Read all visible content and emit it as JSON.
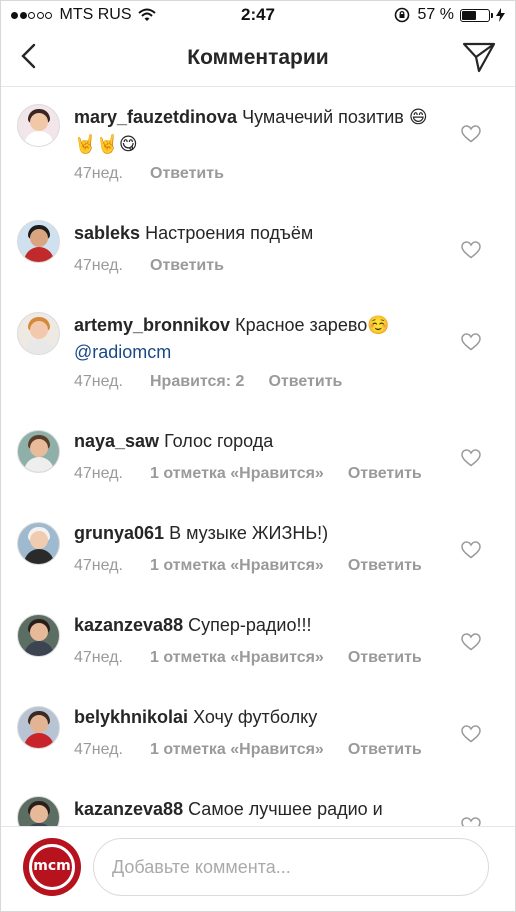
{
  "status_bar": {
    "carrier": "MTS RUS",
    "time": "2:47",
    "battery": "57 %",
    "battery_level": 0.57
  },
  "header": {
    "title": "Комментарии"
  },
  "comments": [
    {
      "username": "mary_fauzetdinova",
      "text": "Чумачечий позитив 😄🤘🤘😋",
      "mention": "",
      "age": "47нед.",
      "likes": "",
      "reply": "Ответить"
    },
    {
      "username": "sableks",
      "text": "Настроения подъём",
      "mention": "",
      "age": "47нед.",
      "likes": "",
      "reply": "Ответить"
    },
    {
      "username": "artemy_bronnikov",
      "text": "Красное зарево☺️",
      "mention": "@radiomcm",
      "age": "47нед.",
      "likes": "Нравится: 2",
      "reply": "Ответить"
    },
    {
      "username": "naya_saw",
      "text": "Голос города",
      "mention": "",
      "age": "47нед.",
      "likes": "1 отметка «Нравится»",
      "reply": "Ответить"
    },
    {
      "username": "grunya061",
      "text": "В музыке ЖИЗНЬ!)",
      "mention": "",
      "age": "47нед.",
      "likes": "1 отметка «Нравится»",
      "reply": "Ответить"
    },
    {
      "username": "kazanzeva88",
      "text": "Супер-радио!!!",
      "mention": "",
      "age": "47нед.",
      "likes": "1 отметка «Нравится»",
      "reply": "Ответить"
    },
    {
      "username": "belykhnikolai",
      "text": "Хочу футболку",
      "mention": "",
      "age": "47нед.",
      "likes": "1 отметка «Нравится»",
      "reply": "Ответить"
    },
    {
      "username": "kazanzeva88",
      "text": "Самое лучшее радио и",
      "mention": "",
      "age": "",
      "likes": "",
      "reply": ""
    }
  ],
  "composer": {
    "avatar_mark": "mcm",
    "placeholder": "Добавьте коммента..."
  },
  "icons": {
    "back": "chevron-left-icon",
    "send": "paper-plane-icon",
    "like": "heart-outline-icon",
    "wifi": "wifi-icon",
    "orientation_lock": "orientation-lock-icon",
    "battery": "battery-icon",
    "charging": "charging-bolt-icon"
  },
  "colors": {
    "text": "#262626",
    "meta": "#9a9a9a",
    "mention": "#1a4a86",
    "brand": "#b6131f"
  }
}
